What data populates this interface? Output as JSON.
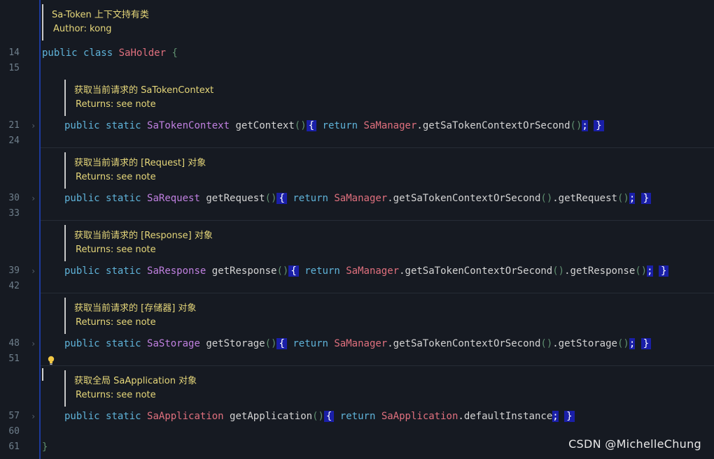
{
  "header_doc": {
    "title": "Sa-Token 上下文持有类",
    "author": "Author: kong"
  },
  "class_decl": {
    "line": "14",
    "kw1": "public",
    "kw2": "class",
    "name": "SaHolder",
    "brace": "{"
  },
  "blank_lines": {
    "after_class": "15",
    "after_context": "24",
    "after_request": "33",
    "after_response": "42",
    "after_storage": "51",
    "after_application": "60"
  },
  "methods": [
    {
      "doc_title": "获取当前请求的 SaTokenContext",
      "doc_returns": "Returns: see note",
      "line": "21",
      "return_type": "SaTokenContext",
      "name": "getContext",
      "manager": "SaManager",
      "call": ".getSaTokenContextOrSecond",
      "tail": ""
    },
    {
      "doc_title": "获取当前请求的 [Request] 对象",
      "doc_returns": "Returns: see note",
      "line": "30",
      "return_type": "SaRequest",
      "name": "getRequest",
      "manager": "SaManager",
      "call": ".getSaTokenContextOrSecond",
      "tail": ".getRequest"
    },
    {
      "doc_title": "获取当前请求的 [Response] 对象",
      "doc_returns": "Returns: see note",
      "line": "39",
      "return_type": "SaResponse",
      "name": "getResponse",
      "manager": "SaManager",
      "call": ".getSaTokenContextOrSecond",
      "tail": ".getResponse"
    },
    {
      "doc_title": "获取当前请求的 [存储器] 对象",
      "doc_returns": "Returns: see note",
      "line": "48",
      "return_type": "SaStorage",
      "name": "getStorage",
      "manager": "SaManager",
      "call": ".getSaTokenContextOrSecond",
      "tail": ".getStorage"
    },
    {
      "doc_title": "获取全局 SaApplication 对象",
      "doc_returns": "Returns: see note",
      "line": "57",
      "return_type": "SaApplication",
      "name": "getApplication",
      "manager": "SaApplication",
      "call": ".defaultInstance",
      "tail": ""
    }
  ],
  "closing": {
    "line": "61",
    "brace": "}"
  },
  "keywords": {
    "public": "public",
    "static": "static",
    "return": "return"
  },
  "watermark": "CSDN @MichelleChung",
  "colors": {
    "background": "#161a22",
    "keyword": "#5fb3d9",
    "type": "#e0707e",
    "doc_text": "#e6d77a",
    "bracket_highlight": "#1a1fa8"
  },
  "icons": {
    "fold": "chevron-right-icon",
    "intention": "lightbulb-icon"
  }
}
